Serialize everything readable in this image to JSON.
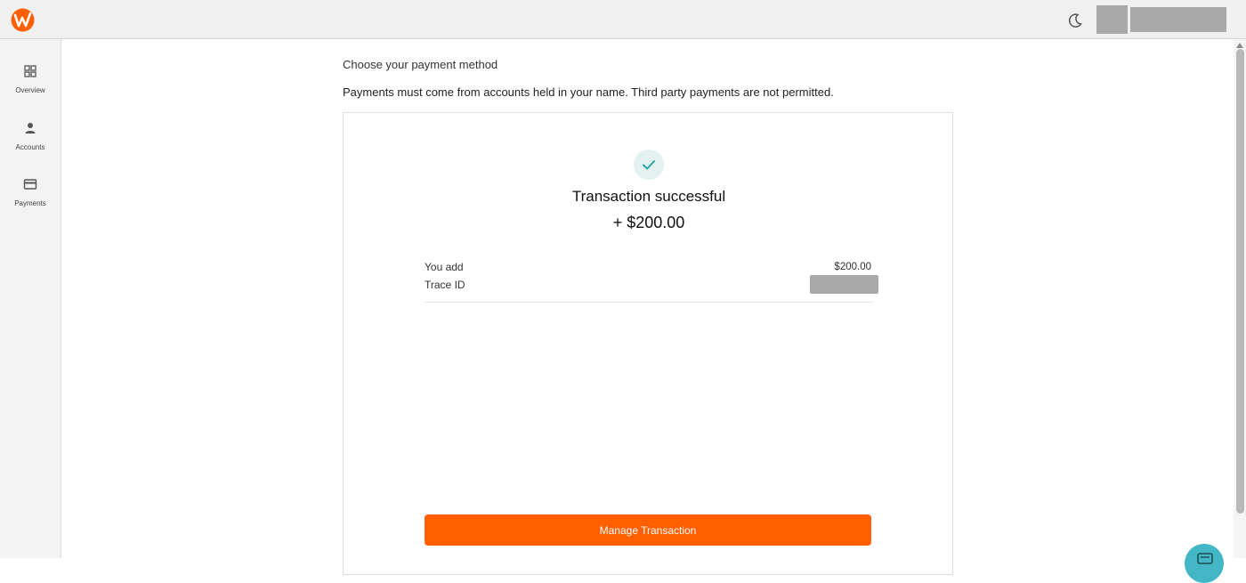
{
  "topbar": {
    "logo_icon": "brand-logo-icon",
    "theme_icon": "moon-icon",
    "brand_color": "#ff5f00"
  },
  "sidebar": {
    "items": [
      {
        "label": "Overview",
        "icon": "grid-icon"
      },
      {
        "label": "Accounts",
        "icon": "person-icon"
      },
      {
        "label": "Payments",
        "icon": "card-icon"
      }
    ]
  },
  "main": {
    "heading": "Choose your payment method",
    "notice": "Payments must come from accounts held in your name. Third party payments are not permitted.",
    "result": {
      "status_icon": "check-icon",
      "title": "Transaction successful",
      "amount": "+ $200.00",
      "rows": [
        {
          "label": "You add",
          "value": "$200.00"
        },
        {
          "label": "Trace ID",
          "value": ""
        }
      ],
      "button_label": "Manage Transaction"
    }
  },
  "chat": {
    "icon": "chat-icon",
    "color": "#43b7c5"
  }
}
